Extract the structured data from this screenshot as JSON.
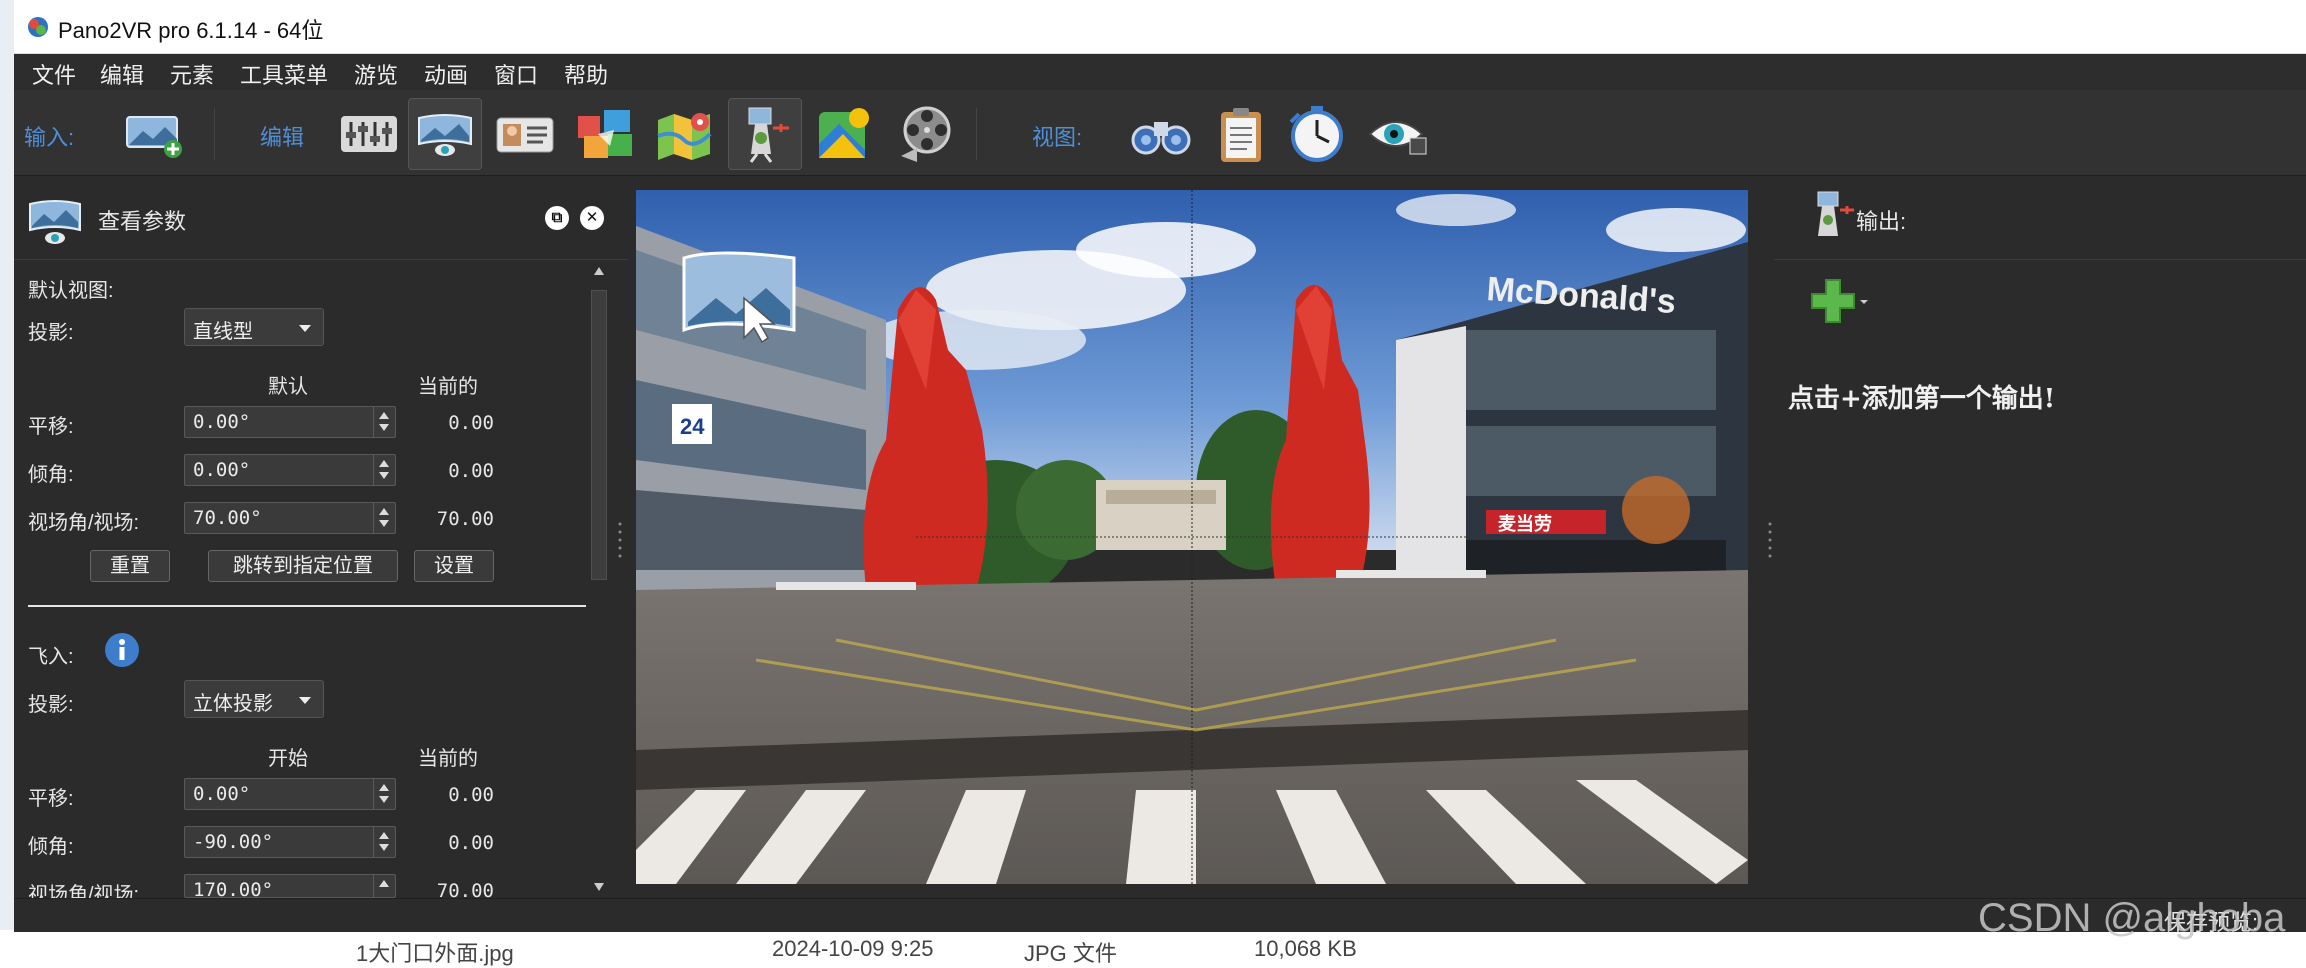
{
  "window": {
    "title": "Pano2VR pro 6.1.14 - 64位"
  },
  "menu": [
    "文件",
    "编辑",
    "元素",
    "工具菜单",
    "游览",
    "动画",
    "窗口",
    "帮助"
  ],
  "toolbar": {
    "input_label": "输入:",
    "edit_label": "编辑",
    "view_label": "视图:",
    "input_buttons": [
      "add-panorama-icon"
    ],
    "edit_buttons": [
      "properties-icon",
      "viewing-parameters-icon",
      "user-data-icon",
      "patch-icon",
      "map-icon",
      "output-icon",
      "google-street-view-icon",
      "animation-icon"
    ],
    "view_buttons": [
      "binoculars-icon",
      "clipboard-icon",
      "clock-icon",
      "eye-icon"
    ]
  },
  "left_panel": {
    "title": "查看参数",
    "default_view": {
      "section_label": "默认视图:",
      "projection_label": "投影:",
      "projection_value": "直线型",
      "col_default": "默认",
      "col_current": "当前的",
      "rows": [
        {
          "label": "平移:",
          "value": "0.00°",
          "current": "0.00"
        },
        {
          "label": "倾角:",
          "value": "0.00°",
          "current": "0.00"
        },
        {
          "label": "视场角/视场:",
          "value": "70.00°",
          "current": "70.00"
        }
      ],
      "buttons": {
        "reset": "重置",
        "goto": "跳转到指定位置",
        "set": "设置"
      }
    },
    "fly_in": {
      "section_label": "飞入:",
      "projection_label": "投影:",
      "projection_value": "立体投影",
      "col_start": "开始",
      "col_current": "当前的",
      "rows": [
        {
          "label": "平移:",
          "value": "0.00°",
          "current": "0.00"
        },
        {
          "label": "倾角:",
          "value": "-90.00°",
          "current": "0.00"
        },
        {
          "label": "视场角/视场:",
          "value": "170.00°",
          "current": "70.00"
        }
      ]
    }
  },
  "viewer": {
    "sign_text": "McDonald's",
    "chinese_sign": "麦当劳",
    "badge": "24"
  },
  "right_panel": {
    "title": "输出:",
    "hint": "点击+添加第一个输出!"
  },
  "background": {
    "file_row": "1大门口外面.jpg",
    "date": "2024-10-09 9:25",
    "type": "JPG 文件",
    "size": "10,068 KB",
    "status_fragment": "保存预览:"
  },
  "watermark": "CSDN @alghoba",
  "colors": {
    "accent": "#4f8fd6",
    "panel": "#2b2b2b",
    "sign_red": "#d22a2a"
  }
}
